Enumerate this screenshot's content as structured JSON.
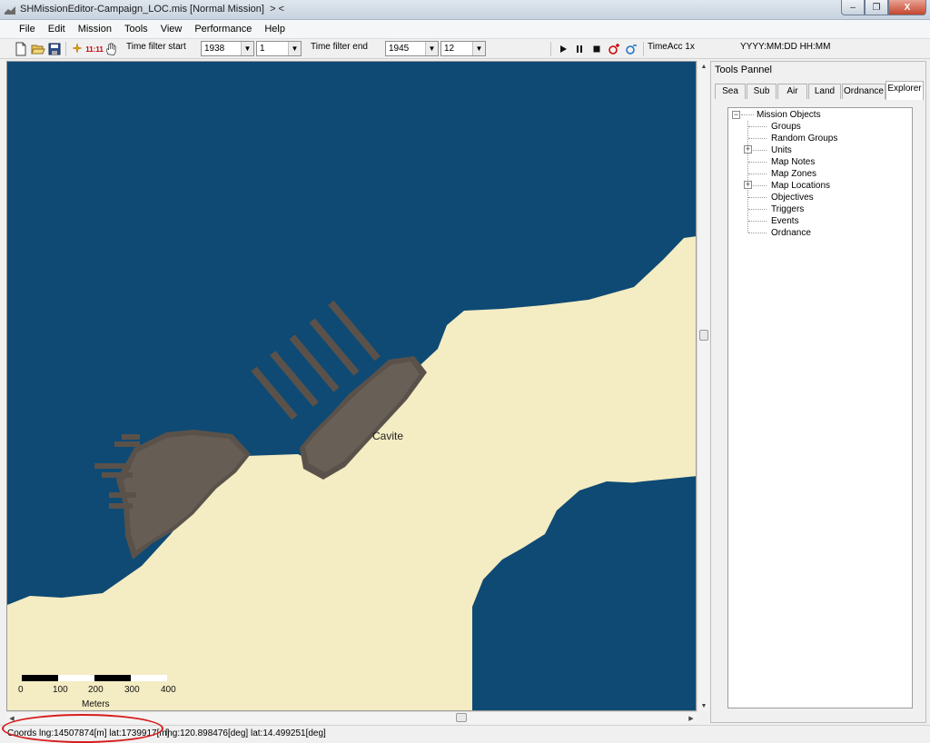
{
  "window": {
    "title": "SHMissionEditor-Campaign_LOC.mis [Normal Mission]",
    "title_suffix": "> <",
    "controls": [
      "–",
      "❐",
      "X"
    ]
  },
  "menu": [
    "File",
    "Edit",
    "Mission",
    "Tools",
    "View",
    "Performance",
    "Help"
  ],
  "toolbar": {
    "clock_icon_label": "11:11",
    "time_filter_start_label": "Time filter start",
    "start_year": "1938",
    "start_month": "1",
    "time_filter_end_label": "Time filter end",
    "end_year": "1945",
    "end_month": "12",
    "time_acc_label": "TimeAcc 1x",
    "date_format": "YYYY:MM:DD HH:MM"
  },
  "map": {
    "place_label": "Cavite",
    "scale_ticks": [
      "0",
      "100",
      "200",
      "300",
      "400"
    ],
    "scale_unit": "Meters",
    "colors": {
      "sea": "#0e4a74",
      "land": "#f4ecc3",
      "port": "#5a524a"
    }
  },
  "tools_panel": {
    "title": "Tools Pannel",
    "tabs": [
      "Sea",
      "Sub",
      "Air",
      "Land",
      "Ordnance",
      "Explorer"
    ],
    "active_tab": "Explorer",
    "tree": {
      "root": "Mission Objects",
      "items": [
        {
          "label": "Groups",
          "expandable": false
        },
        {
          "label": "Random Groups",
          "expandable": false
        },
        {
          "label": "Units",
          "expandable": true
        },
        {
          "label": "Map Notes",
          "expandable": false
        },
        {
          "label": "Map Zones",
          "expandable": false
        },
        {
          "label": "Map Locations",
          "expandable": true
        },
        {
          "label": "Objectives",
          "expandable": false
        },
        {
          "label": "Triggers",
          "expandable": false
        },
        {
          "label": "Events",
          "expandable": false
        },
        {
          "label": "Ordnance",
          "expandable": false
        }
      ]
    }
  },
  "status": {
    "coords_m": "Coords lng:14507874[m] lat:1739917[m]",
    "coords_deg": "lng:120.898476[deg] lat:14.499251[deg]",
    "highlight_color": "#d81c1c"
  }
}
